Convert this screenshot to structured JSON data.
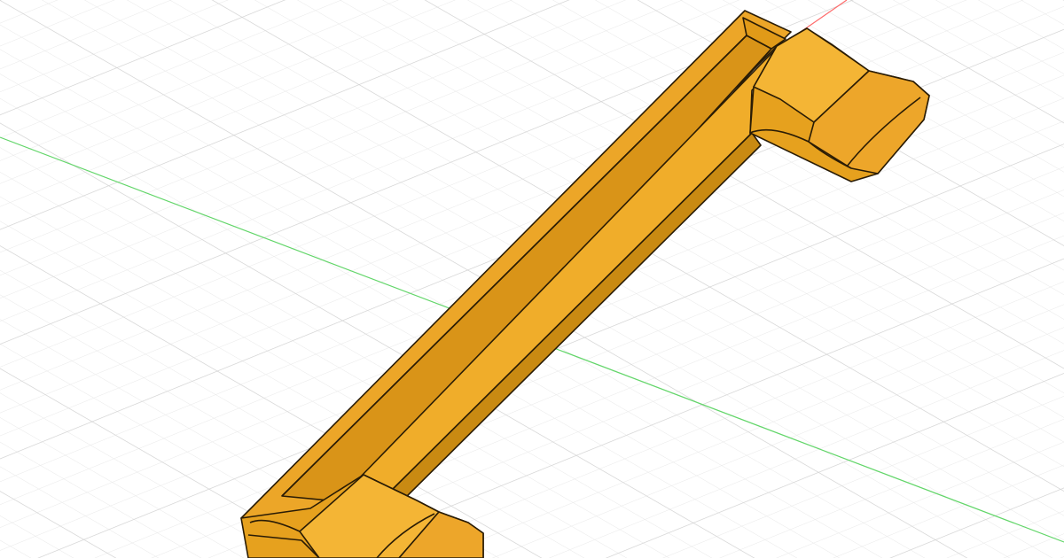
{
  "viewport": {
    "background": "#ffffff",
    "grid_minor_color": "#e6e6e6",
    "grid_major_color": "#cfcfcf",
    "axis_x_color": "#ff6b6b",
    "axis_y_color": "#63d66a"
  },
  "model": {
    "icon": "3d-part-icon",
    "body_color": "#e6a11e",
    "top_color": "#f0ad26",
    "inner_color": "#d48f12",
    "shadow_color": "#b9780b",
    "edge_color": "#2a1c05"
  }
}
